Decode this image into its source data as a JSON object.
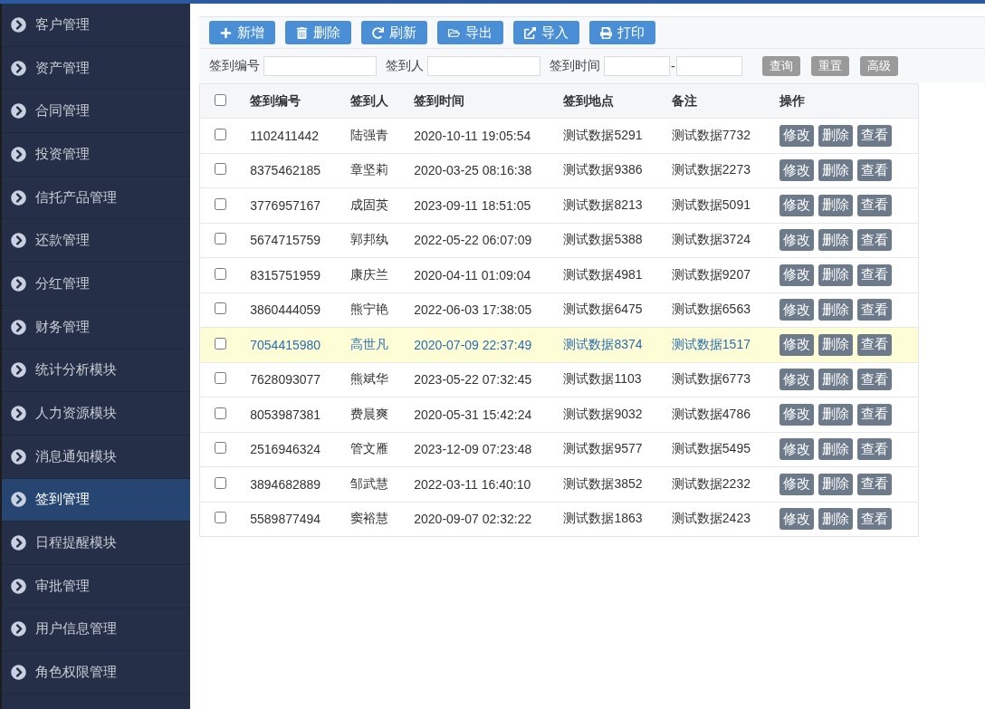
{
  "sidebar": {
    "items": [
      {
        "label": "客户管理",
        "selected": false
      },
      {
        "label": "资产管理",
        "selected": false
      },
      {
        "label": "合同管理",
        "selected": false
      },
      {
        "label": "投资管理",
        "selected": false
      },
      {
        "label": "信托产品管理",
        "selected": false
      },
      {
        "label": "还款管理",
        "selected": false
      },
      {
        "label": "分红管理",
        "selected": false
      },
      {
        "label": "财务管理",
        "selected": false
      },
      {
        "label": "统计分析模块",
        "selected": false
      },
      {
        "label": "人力资源模块",
        "selected": false
      },
      {
        "label": "消息通知模块",
        "selected": false
      },
      {
        "label": "签到管理",
        "selected": true
      },
      {
        "label": "日程提醒模块",
        "selected": false
      },
      {
        "label": "审批管理",
        "selected": false
      },
      {
        "label": "用户信息管理",
        "selected": false
      },
      {
        "label": "角色权限管理",
        "selected": false
      }
    ]
  },
  "toolbar": [
    {
      "kind": "add",
      "label": "新增"
    },
    {
      "kind": "delete",
      "label": "删除"
    },
    {
      "kind": "refresh",
      "label": "刷新"
    },
    {
      "kind": "export",
      "label": "导出"
    },
    {
      "kind": "import",
      "label": "导入"
    },
    {
      "kind": "print",
      "label": "打印"
    }
  ],
  "search": {
    "fields": [
      {
        "label": "签到编号"
      },
      {
        "label": "签到人"
      }
    ],
    "time_label": "签到时间",
    "range_separator": "-",
    "buttons": [
      "查询",
      "重置",
      "高级"
    ]
  },
  "table": {
    "header_checked": false,
    "columns": [
      "签到编号",
      "签到人",
      "签到时间",
      "签到地点",
      "备注",
      "操作"
    ],
    "rows": [
      {
        "checked": false,
        "selected": false,
        "cells": [
          "1102411442",
          "陆强青",
          "2020-10-11 19:05:54",
          "测试数据5291",
          "测试数据7732"
        ],
        "actions": [
          "修改",
          "删除",
          "查看"
        ]
      },
      {
        "checked": false,
        "selected": false,
        "cells": [
          "8375462185",
          "章坚莉",
          "2020-03-25 08:16:38",
          "测试数据9386",
          "测试数据2273"
        ],
        "actions": [
          "修改",
          "删除",
          "查看"
        ]
      },
      {
        "checked": false,
        "selected": false,
        "cells": [
          "3776957167",
          "成固英",
          "2023-09-11 18:51:05",
          "测试数据8213",
          "测试数据5091"
        ],
        "actions": [
          "修改",
          "删除",
          "查看"
        ]
      },
      {
        "checked": false,
        "selected": false,
        "cells": [
          "5674715759",
          "郭邦纨",
          "2022-05-22 06:07:09",
          "测试数据5388",
          "测试数据3724"
        ],
        "actions": [
          "修改",
          "删除",
          "查看"
        ]
      },
      {
        "checked": false,
        "selected": false,
        "cells": [
          "8315751959",
          "康庆兰",
          "2020-04-11 01:09:04",
          "测试数据4981",
          "测试数据9207"
        ],
        "actions": [
          "修改",
          "删除",
          "查看"
        ]
      },
      {
        "checked": false,
        "selected": false,
        "cells": [
          "3860444059",
          "熊宁艳",
          "2022-06-03 17:38:05",
          "测试数据6475",
          "测试数据6563"
        ],
        "actions": [
          "修改",
          "删除",
          "查看"
        ]
      },
      {
        "checked": false,
        "selected": true,
        "cells": [
          "7054415980",
          "高世凡",
          "2020-07-09 22:37:49",
          "测试数据8374",
          "测试数据1517"
        ],
        "actions": [
          "修改",
          "删除",
          "查看"
        ]
      },
      {
        "checked": false,
        "selected": false,
        "cells": [
          "7628093077",
          "熊斌华",
          "2023-05-22 07:32:45",
          "测试数据1103",
          "测试数据6773"
        ],
        "actions": [
          "修改",
          "删除",
          "查看"
        ]
      },
      {
        "checked": false,
        "selected": false,
        "cells": [
          "8053987381",
          "费晨爽",
          "2020-05-31 15:42:24",
          "测试数据9032",
          "测试数据4786"
        ],
        "actions": [
          "修改",
          "删除",
          "查看"
        ]
      },
      {
        "checked": false,
        "selected": false,
        "cells": [
          "2516946324",
          "管文雁",
          "2023-12-09 07:23:48",
          "测试数据9577",
          "测试数据5495"
        ],
        "actions": [
          "修改",
          "删除",
          "查看"
        ]
      },
      {
        "checked": false,
        "selected": false,
        "cells": [
          "3894682889",
          "邹武慧",
          "2022-03-11 16:40:10",
          "测试数据3852",
          "测试数据2232"
        ],
        "actions": [
          "修改",
          "删除",
          "查看"
        ]
      },
      {
        "checked": false,
        "selected": false,
        "cells": [
          "5589877494",
          "窦裕慧",
          "2020-09-07 02:32:22",
          "测试数据1863",
          "测试数据2423"
        ],
        "actions": [
          "修改",
          "删除",
          "查看"
        ]
      }
    ]
  }
}
